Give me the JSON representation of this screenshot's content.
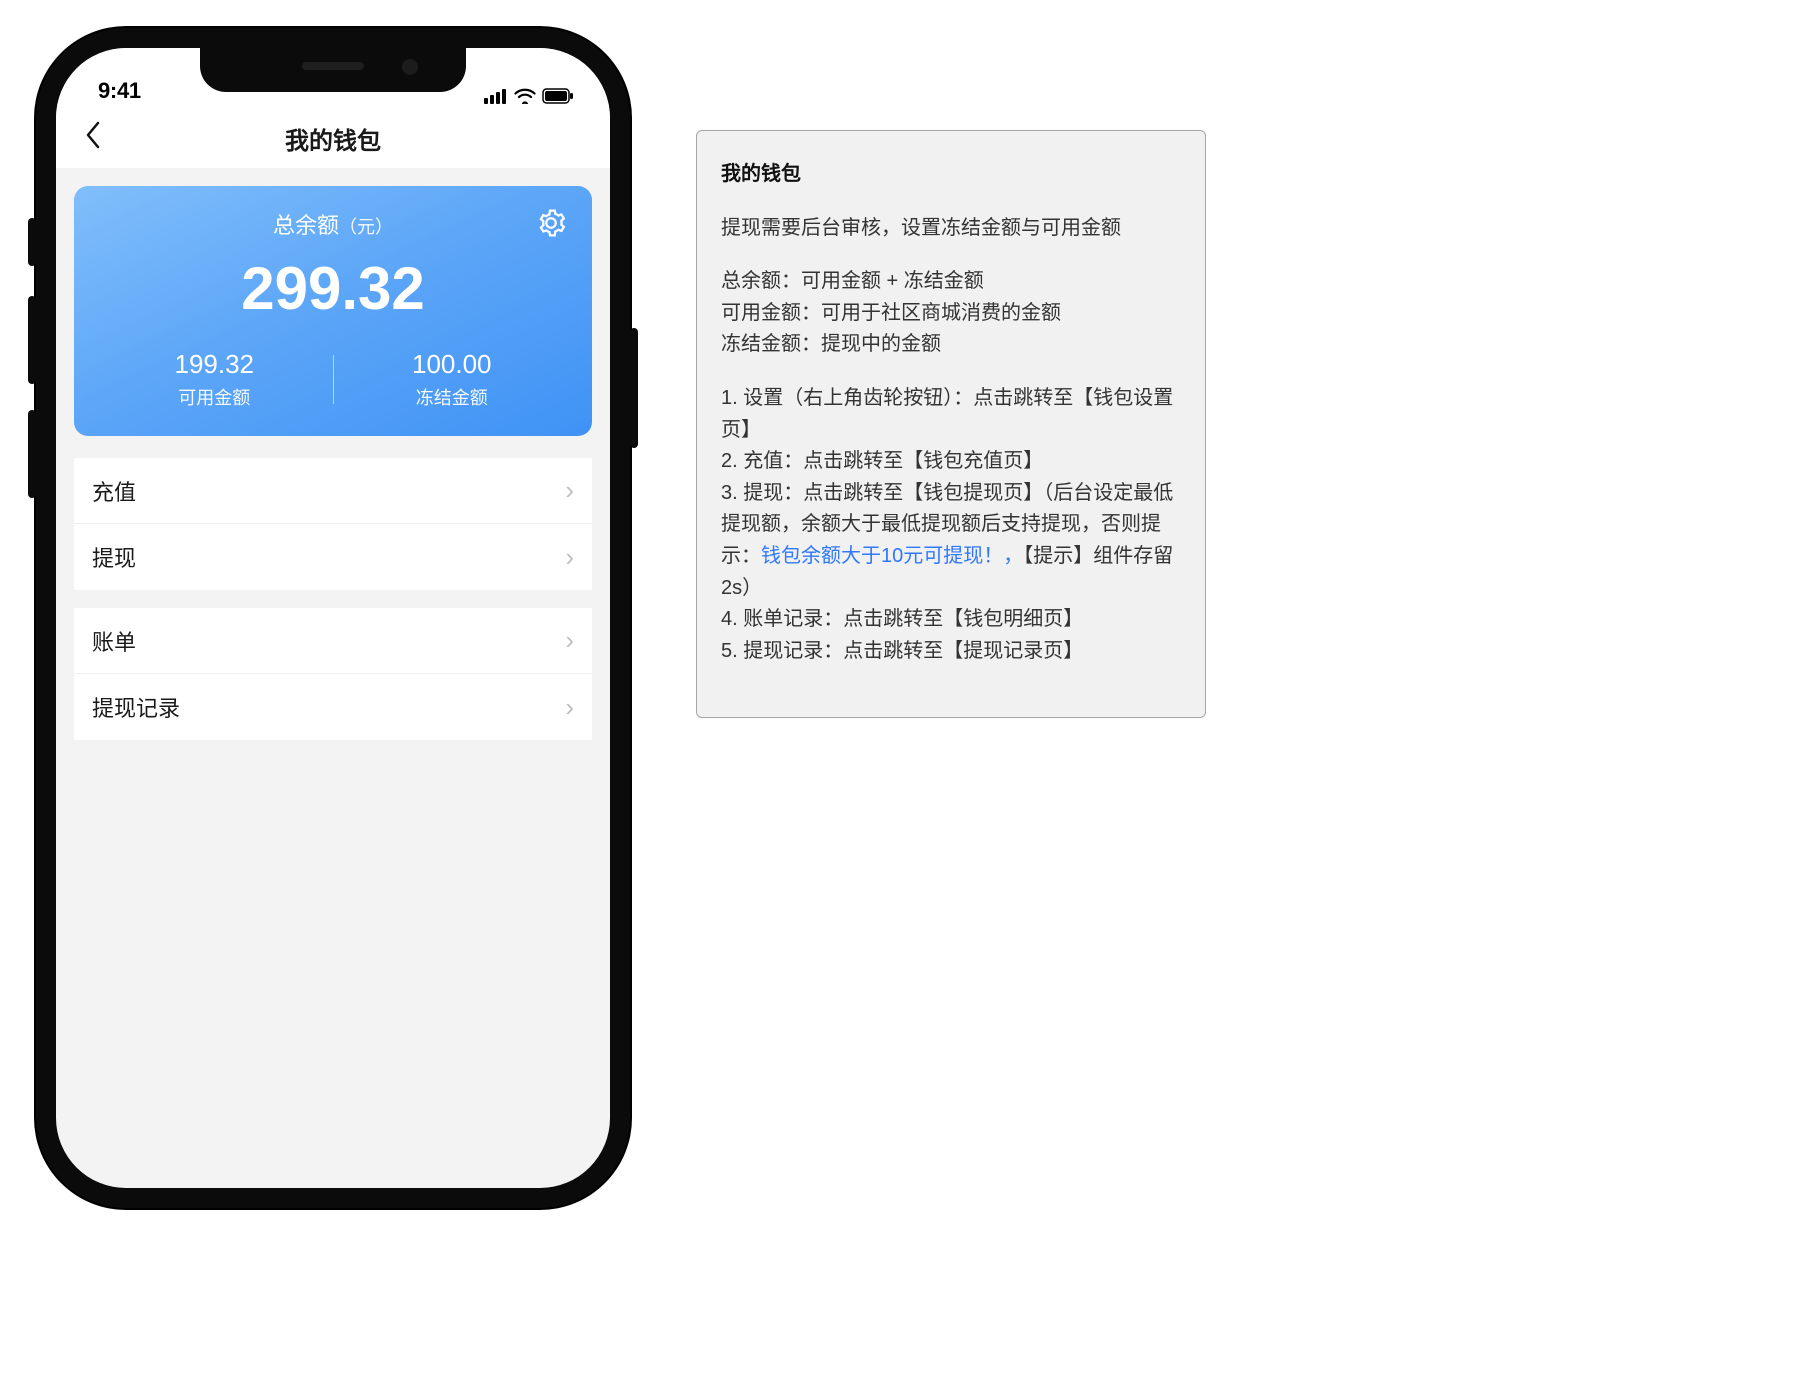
{
  "status": {
    "time": "9:41"
  },
  "nav": {
    "title": "我的钱包"
  },
  "balance": {
    "title": "总余额",
    "unit": "（元）",
    "total": "299.32",
    "available_value": "199.32",
    "available_label": "可用金额",
    "frozen_value": "100.00",
    "frozen_label": "冻结金额"
  },
  "menu": {
    "recharge": "充值",
    "withdraw": "提现",
    "bill": "账单",
    "withdraw_log": "提现记录"
  },
  "spec": {
    "title": "我的钱包",
    "p1": "提现需要后台审核，设置冻结金额与可用金额",
    "p2": "总余额：可用金额 + 冻结金额\n可用金额：可用于社区商城消费的金额\n冻结金额：提现中的金额",
    "p3a": "1. 设置（右上角齿轮按钮）：点击跳转至【钱包设置页】\n2. 充值：点击跳转至【钱包充值页】\n3. 提现：点击跳转至【钱包提现页】（后台设定最低提现额，余额大于最低提现额后支持提现，否则提示：",
    "p3link": "钱包余额大于10元可提现！，",
    "p3b": "【提示】组件存留2s）\n4. 账单记录：点击跳转至【钱包明细页】\n5. 提现记录：点击跳转至【提现记录页】"
  }
}
